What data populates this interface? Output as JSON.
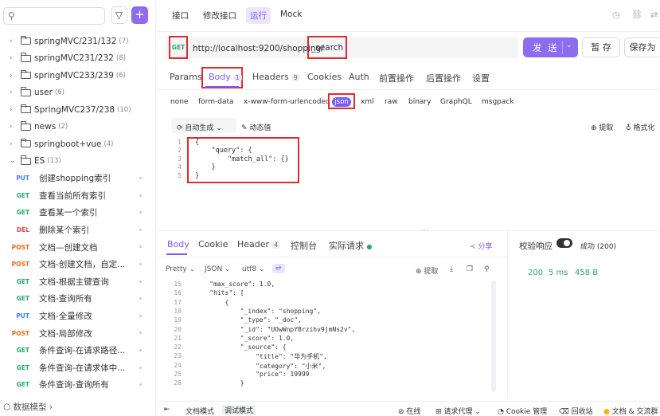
{
  "colors": {
    "accent": "#8e6cef",
    "get": "#2ba86a",
    "put": "#3b82f6",
    "post": "#e0701e",
    "del": "#e54848",
    "highlight": "#e02b2b"
  },
  "sidebar": {
    "search_icon": "search-icon",
    "filter_icon": "filter-icon",
    "add_label": "+",
    "folders": [
      {
        "name": "springMVC/231/132",
        "count": "(7)",
        "expanded": false
      },
      {
        "name": "springMVC231/232",
        "count": "(8)",
        "expanded": false
      },
      {
        "name": "springMVC233/239",
        "count": "(6)",
        "expanded": false
      },
      {
        "name": "user",
        "count": "(6)",
        "expanded": false
      },
      {
        "name": "SpringMVC237/238",
        "count": "(10)",
        "expanded": false
      },
      {
        "name": "news",
        "count": "(2)",
        "expanded": false
      },
      {
        "name": "springboot+vue",
        "count": "(4)",
        "expanded": false
      },
      {
        "name": "ES",
        "count": "(13)",
        "expanded": true
      }
    ],
    "apis": [
      {
        "method": "PUT",
        "name": "创建shopping索引"
      },
      {
        "method": "GET",
        "name": "查看当前所有索引"
      },
      {
        "method": "GET",
        "name": "查看某一个索引"
      },
      {
        "method": "DEL",
        "name": "删除某个索引"
      },
      {
        "method": "POST",
        "name": "文档—创建文档"
      },
      {
        "method": "POST",
        "name": "文档-创建文档，自定..."
      },
      {
        "method": "GET",
        "name": "文档-根据主键查询"
      },
      {
        "method": "GET",
        "name": "文档-查询所有"
      },
      {
        "method": "PUT",
        "name": "文档-全量修改"
      },
      {
        "method": "POST",
        "name": "文档-局部修改"
      },
      {
        "method": "GET",
        "name": "条件查询-在请求路径..."
      },
      {
        "method": "GET",
        "name": "条件查询-在请求体中..."
      },
      {
        "method": "GET",
        "name": "条件查询-查询所有"
      }
    ],
    "data_model": "数据模型"
  },
  "top_tabs": [
    "接口",
    "修改接口",
    "运行",
    "Mock"
  ],
  "active_top_tab": "运行",
  "request": {
    "method": "GET",
    "url_prefix": "http://localhost:9200/shopping/",
    "url_path": "_search",
    "send": "发 送",
    "save_draft": "暂 存",
    "save_as": "保存为"
  },
  "req_tabs": {
    "params": "Params",
    "body": "Body",
    "body_badge": "1",
    "headers": "Headers",
    "headers_badge": "9",
    "cookies": "Cookies",
    "auth": "Auth",
    "pre": "前置操作",
    "post": "后置操作",
    "settings": "设置"
  },
  "body_types": [
    "none",
    "form-data",
    "x-www-form-urlencoded",
    "json",
    "xml",
    "raw",
    "binary",
    "GraphQL",
    "msgpack"
  ],
  "body_tools": {
    "autogen": "自动生成",
    "dynamic": "动态值",
    "extract": "提取",
    "format": "格式化"
  },
  "request_body": {
    "line_numbers": [
      "1",
      "2",
      "3",
      "4",
      "5"
    ],
    "lines": [
      "{",
      "    \"query\": {",
      "        \"match_all\": {}",
      "    }",
      "}"
    ]
  },
  "resp_tabs": {
    "body": "Body",
    "cookie": "Cookie",
    "header": "Header",
    "header_badge": "4",
    "console": "控制台",
    "actual": "实际请求",
    "share": "分享"
  },
  "resp_tools": {
    "pretty": "Pretty",
    "format": "JSON",
    "encoding": "utf8",
    "extract": "提取"
  },
  "response_body": {
    "line_numbers": [
      "15",
      "16",
      "17",
      "18",
      "19",
      "20",
      "21",
      "22",
      "23",
      "24",
      "25",
      "26"
    ],
    "lines": [
      "    \"max_score\": 1.0,",
      "    \"hits\": [",
      "        {",
      "            \"_index\": \"shopping\",",
      "            \"_type\": \"_doc\",",
      "            \"_id\": \"UOwWnpYBrzihv9jmNs2v\",",
      "            \"_score\": 1.0,",
      "            \"_source\": {",
      "                \"title\": \"华为手机\",",
      "                \"category\": \"小米\",",
      "                \"price\": 19999",
      "            }"
    ]
  },
  "validation": {
    "label": "校验响应",
    "status": "成功 (200)",
    "code": "200",
    "time": "5 ms",
    "size": "458 B"
  },
  "bottom": {
    "doc_mode": "文档模式",
    "debug_mode": "调试模式",
    "online": "在线",
    "proxy": "请求代理",
    "cookie": "Cookie 管理",
    "recycle": "回收站",
    "docs": "文档 & 交流群"
  }
}
